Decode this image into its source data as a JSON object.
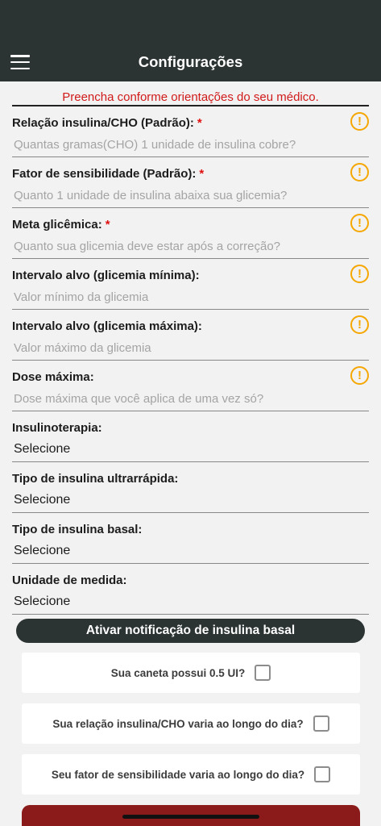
{
  "header": {
    "title": "Configurações",
    "menu_icon": "hamburger-menu-icon"
  },
  "notice": "Preencha conforme orientações do seu médico.",
  "fields": [
    {
      "label": "Relação insulina/CHO (Padrão):",
      "required": true,
      "placeholder": "Quantas gramas(CHO) 1 unidade de insulina cobre?",
      "info": true
    },
    {
      "label": "Fator de sensibilidade (Padrão):",
      "required": true,
      "placeholder": "Quanto 1 unidade de insulina abaixa sua glicemia?",
      "info": true
    },
    {
      "label": "Meta glicêmica:",
      "required": true,
      "placeholder": "Quanto sua glicemia deve estar após a correção?",
      "info": true
    },
    {
      "label": "Intervalo alvo (glicemia mínima):",
      "required": false,
      "placeholder": "Valor mínimo da glicemia",
      "info": true
    },
    {
      "label": "Intervalo alvo (glicemia máxima):",
      "required": false,
      "placeholder": "Valor máximo da glicemia",
      "info": true
    },
    {
      "label": "Dose máxima:",
      "required": false,
      "placeholder": "Dose máxima que você aplica de uma vez só?",
      "info": true
    }
  ],
  "selects": [
    {
      "label": "Insulinoterapia:",
      "value": "Selecione"
    },
    {
      "label": "Tipo de insulina ultrarrápida:",
      "value": "Selecione"
    },
    {
      "label": "Tipo de insulina basal:",
      "value": "Selecione"
    },
    {
      "label": "Unidade de medida:",
      "value": "Selecione"
    }
  ],
  "required_mark": "*",
  "info_mark": "!",
  "basal_button": "Ativar notificação de insulina basal",
  "checks": [
    {
      "label": "Sua caneta possui 0.5 UI?",
      "checked": false
    },
    {
      "label": "Sua relação insulina/CHO varia ao longo do dia?",
      "checked": false
    },
    {
      "label": "Seu fator de sensibilidade varia ao longo do dia?",
      "checked": false
    }
  ],
  "colors": {
    "header": "#2b3333",
    "notice": "#d11a1a",
    "required": "#e01010",
    "warning": "#f5a700",
    "bottom_button": "#8b1a1a"
  }
}
